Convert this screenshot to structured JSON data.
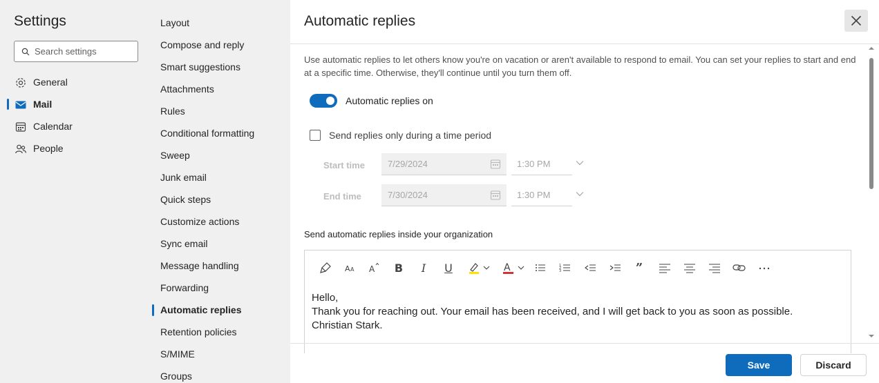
{
  "settings": {
    "title": "Settings",
    "search_placeholder": "Search settings",
    "categories": [
      {
        "label": "General",
        "icon": "gear-icon"
      },
      {
        "label": "Mail",
        "icon": "mail-icon",
        "active": true
      },
      {
        "label": "Calendar",
        "icon": "calendar-icon"
      },
      {
        "label": "People",
        "icon": "people-icon"
      }
    ]
  },
  "mail_nav": {
    "items": [
      "Layout",
      "Compose and reply",
      "Smart suggestions",
      "Attachments",
      "Rules",
      "Conditional formatting",
      "Sweep",
      "Junk email",
      "Quick steps",
      "Customize actions",
      "Sync email",
      "Message handling",
      "Forwarding",
      "Automatic replies",
      "Retention policies",
      "S/MIME",
      "Groups"
    ],
    "active": "Automatic replies"
  },
  "panel": {
    "title": "Automatic replies",
    "description": "Use automatic replies to let others know you're on vacation or aren't available to respond to email. You can set your replies to start and end at a specific time. Otherwise, they'll continue until you turn them off.",
    "toggle_label": "Automatic replies on",
    "toggle_on": true,
    "time_period_label": "Send replies only during a time period",
    "time_period_checked": false,
    "start_label": "Start time",
    "start_date": "7/29/2024",
    "start_time": "1:30 PM",
    "end_label": "End time",
    "end_date": "7/30/2024",
    "end_time": "1:30 PM",
    "inside_org_label": "Send automatic replies inside your organization",
    "message_lines": [
      "Hello,",
      "Thank you for reaching out. Your email has been received, and I will get back to you as soon as possible.",
      "Christian Stark."
    ],
    "save_label": "Save",
    "discard_label": "Discard"
  },
  "colors": {
    "accent": "#0f6cbd",
    "highlight": "#ffe100",
    "font_color": "#d13438"
  }
}
